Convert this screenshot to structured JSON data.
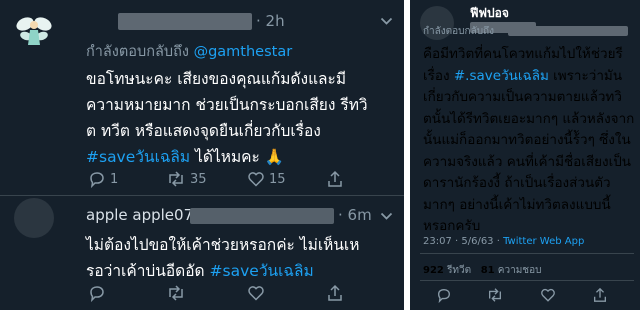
{
  "colors": {
    "background": "#15202b",
    "link": "#1da1f2",
    "muted": "#8899a6",
    "text": "#ffffff"
  },
  "tweet1": {
    "time": "· 2h",
    "reply_prefix": "กำลังตอบกลับถึง",
    "reply_handle": "@gamthestar",
    "text_lines": [
      "ขอโทษนะคะ เสียงของคุณแก้มดังและมี",
      "ความหมายมาก ช่วยเป็นกระบอกเสียง รีทวิ",
      "ต ทวีต หรือแสดงจุดยืนเกี่ยวกับเรื่อง"
    ],
    "hashtag": "#saveวันเฉลิม",
    "text_end": "ได้ไหมคะ",
    "emoji": "🙏",
    "actions": {
      "reply_count": "1",
      "retweet_count": "35",
      "like_count": "15"
    }
  },
  "tweet2": {
    "display_name": "apple apple07",
    "time": "· 6m",
    "text_line1": "ไม่ต้องไปขอให้เค้าช่วยหรอกค่ะ ไม่เห็นเห",
    "text_line2_prefix": "รอว่าเค้าบ่นอีดอัด",
    "hashtag": "#saveวันเฉลิม"
  },
  "right_tweet": {
    "display_name": "ฟีฟปอจ",
    "reply_prefix": "กำลังตอบกลับถึง",
    "text_pre": "คือมีทวิตที่คนโควทแก้มไปให้ช่วยรีเรื่อง",
    "hashtag": "#.saveวันเฉลิม",
    "text_post": "เพราะว่ามันเกี่ยวกับความเป็นความตายแล้วทวิตนั้นได้รีทวิตเยอะมากๆ แล้วหลังจากนั้นแม่ก็ออกมาทวิตอย่างนี้ร้ัวๆ ซึ่งในความจริงแล้ว คนที่เค้ามีชื่อเสียงเป็นดารานักร้องงี้ ถ้าเป็นเรื่องส่วนตัวมากๆ อย่างนี้เค้าไม่ทวิตลงแบบนี้หรอกครับ",
    "timestamp": "23:07 · 5/6/63 ·",
    "client": "Twitter Web App",
    "retweets_value": "922",
    "retweets_label": "รีทวีต",
    "likes_value": "81",
    "likes_label": "ความชอบ"
  }
}
